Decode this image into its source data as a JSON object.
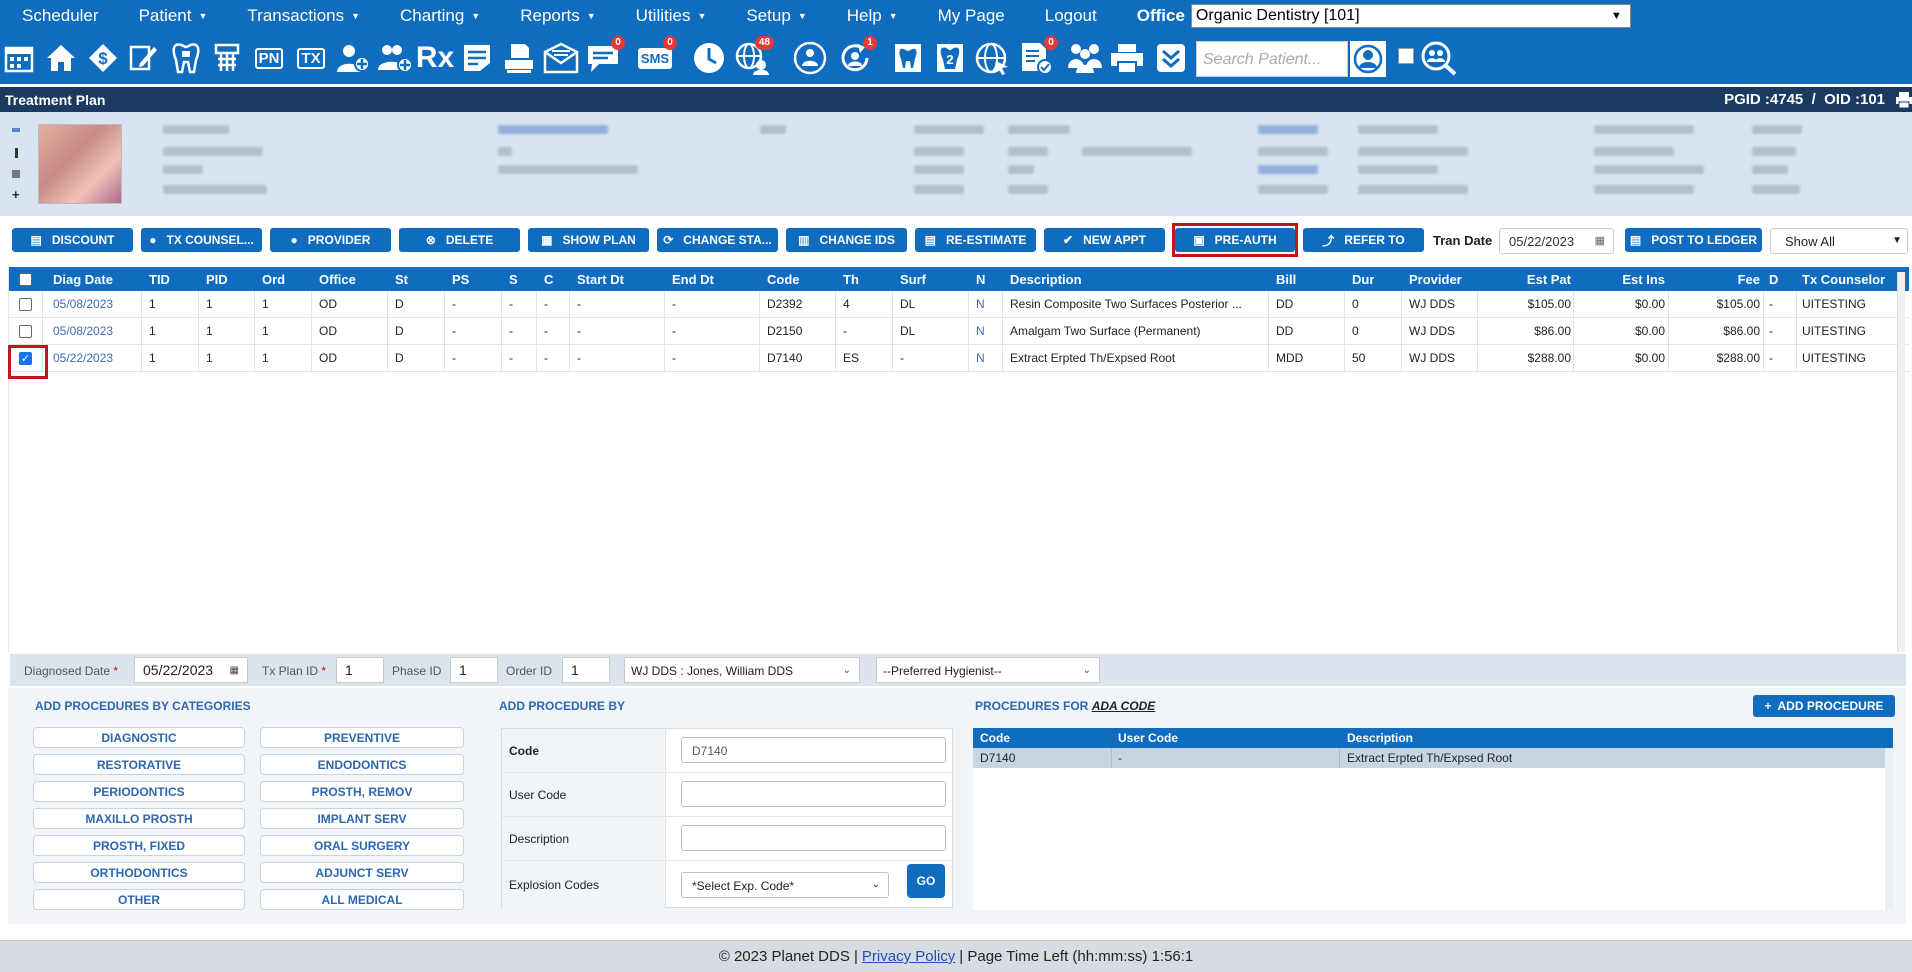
{
  "nav": {
    "items": [
      "Scheduler",
      "Patient",
      "Transactions",
      "Charting",
      "Reports",
      "Utilities",
      "Setup",
      "Help",
      "My Page",
      "Logout"
    ],
    "office_label": "Office",
    "office_value": "Organic Dentistry [101]"
  },
  "toolbar": {
    "pn_label": "PN",
    "tx_label": "TX",
    "sms_label": "SMS",
    "rx_label": "Rx",
    "badges": {
      "messages": "0",
      "sms": "0",
      "globe": "48",
      "recall": "1",
      "docs": "0"
    },
    "search_placeholder": "Search Patient...",
    "icons": [
      "calendar-icon",
      "home-icon",
      "dollar-icon",
      "pencil-icon",
      "tooth-icon",
      "implant-icon",
      "pn-icon",
      "tx-icon",
      "add-patient-icon",
      "add-family-icon",
      "rx-icon",
      "notes-icon",
      "scanner-icon",
      "email-icon",
      "messages-icon",
      "sms-icon",
      "clock-icon",
      "globe-user-icon",
      "people-globe-icon",
      "recall-icon",
      "tooth-outline-icon",
      "tooth-chart-icon",
      "web-icon",
      "document-icon",
      "group-icon",
      "print-icon",
      "collapse-icon"
    ]
  },
  "page": {
    "title": "Treatment Plan",
    "pgid": "PGID :4745",
    "sep": "/",
    "oid": "OID :101"
  },
  "actions": {
    "discount": "DISCOUNT",
    "tx_counsel": "TX COUNSEL...",
    "provider": "PROVIDER",
    "delete": "DELETE",
    "show_plan": "SHOW PLAN",
    "change_status": "CHANGE STA...",
    "change_ids": "CHANGE IDS",
    "re_estimate": "RE-ESTIMATE",
    "new_appt": "NEW APPT",
    "pre_auth": "PRE-AUTH",
    "refer_to": "REFER TO",
    "tran_date_label": "Tran Date",
    "tran_date": "05/22/2023",
    "post_ledger": "POST TO LEDGER",
    "show_filter": "Show All"
  },
  "grid": {
    "columns": [
      "Diag Date",
      "TID",
      "PID",
      "Ord",
      "Office",
      "St",
      "PS",
      "S",
      "C",
      "Start Dt",
      "End Dt",
      "Code",
      "Th",
      "Surf",
      "N",
      "Description",
      "Bill",
      "Dur",
      "Provider",
      "Est Pat",
      "Est Ins",
      "Fee",
      "D",
      "Tx Counselor"
    ],
    "rows": [
      {
        "checked": false,
        "diag_date": "05/08/2023",
        "tid": "1",
        "pid": "1",
        "ord": "1",
        "office": "OD",
        "st": "D",
        "ps": "-",
        "s": "-",
        "c": "-",
        "start_dt": "-",
        "end_dt": "-",
        "code": "D2392",
        "th": "4",
        "surf": "DL",
        "n": "N",
        "description": "Resin Composite Two Surfaces Posterior ...",
        "bill": "DD",
        "dur": "0",
        "provider": "WJ DDS",
        "est_pat": "$105.00",
        "est_ins": "$0.00",
        "fee": "$105.00",
        "d": "-",
        "counselor": "UITESTING"
      },
      {
        "checked": false,
        "diag_date": "05/08/2023",
        "tid": "1",
        "pid": "1",
        "ord": "1",
        "office": "OD",
        "st": "D",
        "ps": "-",
        "s": "-",
        "c": "-",
        "start_dt": "-",
        "end_dt": "-",
        "code": "D2150",
        "th": "-",
        "surf": "DL",
        "n": "N",
        "description": "Amalgam Two Surface (Permanent)",
        "bill": "DD",
        "dur": "0",
        "provider": "WJ DDS",
        "est_pat": "$86.00",
        "est_ins": "$0.00",
        "fee": "$86.00",
        "d": "-",
        "counselor": "UITESTING"
      },
      {
        "checked": true,
        "diag_date": "05/22/2023",
        "tid": "1",
        "pid": "1",
        "ord": "1",
        "office": "OD",
        "st": "D",
        "ps": "-",
        "s": "-",
        "c": "-",
        "start_dt": "-",
        "end_dt": "-",
        "code": "D7140",
        "th": "ES",
        "surf": "-",
        "n": "N",
        "description": "Extract Erpted Th/Expsed Root",
        "bill": "MDD",
        "dur": "50",
        "provider": "WJ DDS",
        "est_pat": "$288.00",
        "est_ins": "$0.00",
        "fee": "$288.00",
        "d": "-",
        "counselor": "UITESTING"
      }
    ]
  },
  "filters": {
    "diag_date_label": "Diagnosed Date",
    "req": "*",
    "diag_date": "05/22/2023",
    "txplan_label": "Tx Plan ID",
    "txplan": "1",
    "phase_label": "Phase ID",
    "phase": "1",
    "order_label": "Order ID",
    "order": "1",
    "provider": "WJ DDS : Jones, William DDS",
    "hygienist": "--Preferred Hygienist--"
  },
  "categories": {
    "title": "ADD PROCEDURES BY CATEGORIES",
    "left": [
      "DIAGNOSTIC",
      "RESTORATIVE",
      "PERIODONTICS",
      "MAXILLO PROSTH",
      "PROSTH, FIXED",
      "ORTHODONTICS",
      "OTHER"
    ],
    "right": [
      "PREVENTIVE",
      "ENDODONTICS",
      "PROSTH, REMOV",
      "IMPLANT SERV",
      "ORAL SURGERY",
      "ADJUNCT SERV",
      "ALL MEDICAL"
    ]
  },
  "add_by": {
    "title": "ADD PROCEDURE BY",
    "code_label": "Code",
    "code_value": "D7140",
    "user_code_label": "User Code",
    "description_label": "Description",
    "explosion_label": "Explosion Codes",
    "explosion_value": "*Select Exp. Code*",
    "go": "GO"
  },
  "procs": {
    "title": "PROCEDURES FOR",
    "title_link": "ADA CODE",
    "add_button": "ADD PROCEDURE",
    "columns": [
      "Code",
      "User Code",
      "Description"
    ],
    "row": {
      "code": "D7140",
      "user_code": "-",
      "description": "Extract Erpted Th/Expsed Root"
    }
  },
  "footer": {
    "copyright": "© 2023 Planet DDS |",
    "privacy": "Privacy Policy",
    "time": "| Page Time Left (hh:mm:ss) 1:56:1"
  },
  "colors": {
    "primary": "#0f6cbf",
    "title_bar": "#1b3a5f",
    "highlight": "#c0161d"
  }
}
